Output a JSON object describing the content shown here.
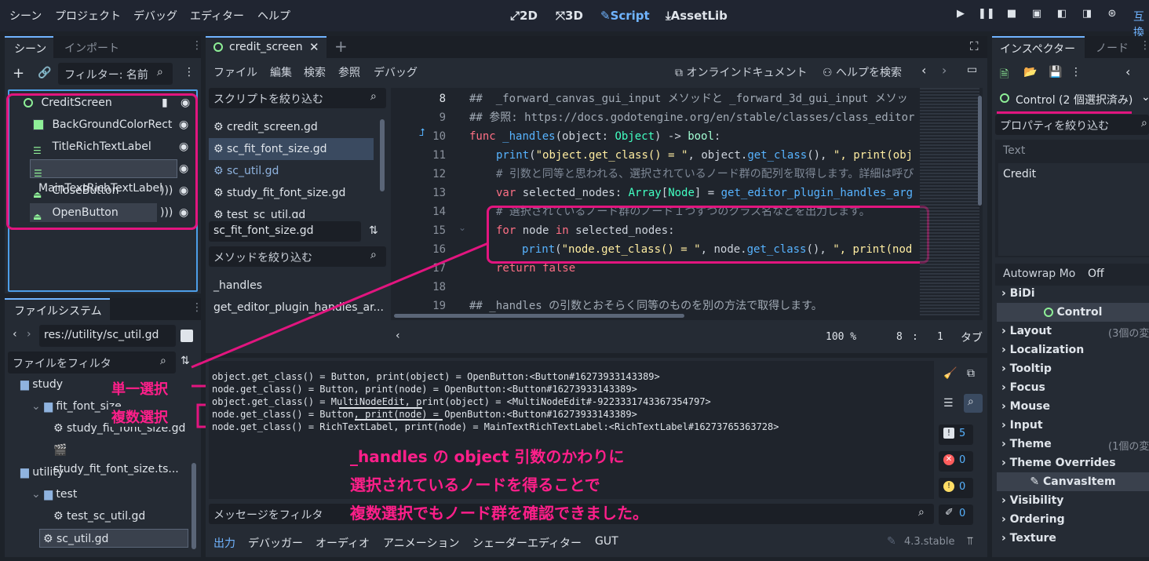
{
  "menu": [
    "シーン",
    "プロジェクト",
    "デバッグ",
    "エディター",
    "ヘルプ"
  ],
  "modes": {
    "m2d": "2D",
    "m3d": "3D",
    "script": "Script",
    "assetlib": "AssetLib"
  },
  "compat": "互換",
  "scene_dock": {
    "tab1": "シーン",
    "tab2": "インポート",
    "filter_placeholder": "フィルター: 名前",
    "nodes": [
      {
        "label": "CreditScreen"
      },
      {
        "label": "BackGroundColorRect"
      },
      {
        "label": "TitleRichTextLabel"
      },
      {
        "label": "MainTextRichTextLabel"
      },
      {
        "label": "CloseButton"
      },
      {
        "label": "OpenButton"
      }
    ]
  },
  "fs_dock": {
    "title": "ファイルシステム",
    "path": "res://utility/sc_util.gd",
    "filter": "ファイルをフィルタ",
    "items": [
      {
        "label": "study"
      },
      {
        "label": "fit_font_size"
      },
      {
        "label": "study_fit_font_size.gd"
      },
      {
        "label": "study_fit_font_size.ts..."
      },
      {
        "label": "utility"
      },
      {
        "label": "test"
      },
      {
        "label": "test_sc_util.gd"
      },
      {
        "label": "sc_util.gd"
      }
    ]
  },
  "script_tab": "credit_screen",
  "script_menu": [
    "ファイル",
    "編集",
    "検索",
    "参照",
    "デバッグ"
  ],
  "online_doc": "オンラインドキュメント",
  "help_search": "ヘルプを検索",
  "script_filter": "スクリプトを絞り込む",
  "scripts": [
    "credit_screen.gd",
    "sc_fit_font_size.gd",
    "sc_util.gd",
    "study_fit_font_size.gd",
    "test_sc_util.gd"
  ],
  "current_script": "sc_fit_font_size.gd",
  "method_filter": "メソッドを絞り込む",
  "methods": [
    "_handles",
    "get_editor_plugin_handles_ar..."
  ],
  "line_numbers": [
    "8",
    "9",
    "10",
    "11",
    "12",
    "13",
    "14",
    "15",
    "16",
    "17",
    "18",
    "19"
  ],
  "code": {
    "l8": "##  _forward_canvas_gui_input メソッドと _forward_3d_gui_input メソッ",
    "l9": "## 参照: https://docs.godotengine.org/en/stable/classes/class_editor",
    "l10_kw": "func",
    "l10_fn": "_handles",
    "l10_a": "(object: ",
    "l10_ty": "Object",
    "l10_b": ") -> ",
    "l10_bool": "bool",
    "l10_c": ":",
    "l11_fn": "print",
    "l11_a": "(",
    "l11_s1": "\"object.get_class() = \"",
    "l11_b": ", object.",
    "l11_fn2": "get_class",
    "l11_c": "(), ",
    "l11_s2": "\", print(obj",
    "l12": "# 引数と同等と思われる、選択されているノード群の配列を取得します。詳細は呼び",
    "l13_kw": "var",
    "l13_a": " selected_nodes: ",
    "l13_ty": "Array",
    "l13_b": "[",
    "l13_ty2": "Node",
    "l13_c": "] = ",
    "l13_fn": "get_editor_plugin_handles_arg",
    "l14": "# 選択されているノード群のノード１つずつのクラス名などを出力します。",
    "l15_kw": "for",
    "l15_a": " node ",
    "l15_kw2": "in",
    "l15_b": " selected_nodes:",
    "l16_fn": "print",
    "l16_a": "(",
    "l16_s1": "\"node.get_class() = \"",
    "l16_b": ", node.",
    "l16_fn2": "get_class",
    "l16_c": "(), ",
    "l16_s2": "\", print(nod",
    "l17_kw": "return",
    "l17_a": " ",
    "l17_kw2": "false",
    "l19": "## _handles の引数とおそらく同等のものを別の方法で取得します。"
  },
  "status": {
    "zoom": "100 %",
    "line": "8",
    "colsep": ":",
    "col": "1",
    "indent": "タブ"
  },
  "output": [
    "object.get_class() = Button, print(object) = OpenButton:<Button#16273933143389>",
    "node.get_class() = Button, print(node) = OpenButton:<Button#16273933143389>",
    "object.get_class() = MultiNodeEdit, print(object) = <MultiNodeEdit#-9223331743367354797>",
    "node.get_class() = Button, print(node) = OpenButton:<Button#16273933143389>",
    "node.get_class() = RichTextLabel, print(node) = MainTextRichTextLabel:<RichTextLabel#16273765363728>"
  ],
  "message_filter": "メッセージをフィルタ",
  "counters": {
    "a": "5",
    "b": "0",
    "c": "0",
    "d": "0"
  },
  "bottom_tabs": [
    "出力",
    "デバッガー",
    "オーディオ",
    "アニメーション",
    "シェーダーエディター",
    "GUT"
  ],
  "version": "4.3.stable",
  "annotations": {
    "single": "単一選択",
    "multi": "複数選択",
    "note1": "_handles の object 引数のかわりに",
    "note2": "選択されているノードを得ることで",
    "note3": "複数選択でもノード群を確認できました。"
  },
  "inspector": {
    "tab1": "インスペクター",
    "tab2": "ノード",
    "object": "Control (2 個選択済み)",
    "filter": "プロパティを絞り込む",
    "text_label": "Text",
    "text_value": "Credit",
    "autowrap_label": "Autowrap Mo",
    "autowrap_value": "Off",
    "rows": [
      "BiDi",
      "Layout",
      "Localization",
      "Tooltip",
      "Focus",
      "Mouse",
      "Input",
      "Theme",
      "Theme Overrides",
      "Visibility",
      "Ordering",
      "Texture"
    ],
    "sec_control": "Control",
    "sec_canvas": "CanvasItem",
    "layout_hint": "(3個の変",
    "theme_hint": "(1個の変"
  }
}
